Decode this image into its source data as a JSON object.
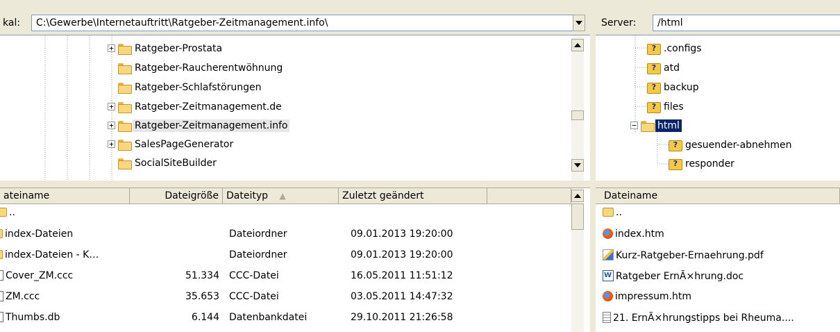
{
  "local": {
    "label": "kal:",
    "path": "C:\\Gewerbe\\Internetauftritt\\Ratgeber-Zeitmanagement.info\\",
    "tree": [
      {
        "label": "Ratgeber-Prostata",
        "expander": "+"
      },
      {
        "label": "Ratgeber-Raucherentwöhnung",
        "expander": ""
      },
      {
        "label": "Ratgeber-Schlafstörungen",
        "expander": ""
      },
      {
        "label": "Ratgeber-Zeitmanagement.de",
        "expander": "+"
      },
      {
        "label": "Ratgeber-Zeitmanagement.info",
        "expander": "+",
        "selected": true
      },
      {
        "label": "SalesPageGenerator",
        "expander": "+"
      },
      {
        "label": "SocialSiteBuilder",
        "expander": ""
      }
    ],
    "columns": [
      "ateiname",
      "Dateigröße",
      "Dateityp",
      "Zuletzt geändert"
    ],
    "sort_icon": "sort-ascending-icon",
    "files": [
      {
        "icon": "folder-up-icon",
        "name": "..",
        "size": "",
        "type": "",
        "modified": ""
      },
      {
        "icon": "folder-icon",
        "name": "index-Dateien",
        "size": "",
        "type": "Dateiordner",
        "modified": "09.01.2013 19:20:00"
      },
      {
        "icon": "folder-icon",
        "name": "index-Dateien - K…",
        "size": "",
        "type": "Dateiordner",
        "modified": "09.01.2013 19:20:00"
      },
      {
        "icon": "file-icon",
        "name": "Cover_ZM.ccc",
        "size": "51.334",
        "type": "CCC-Datei",
        "modified": "16.05.2011 11:51:12"
      },
      {
        "icon": "file-icon",
        "name": "ZM.ccc",
        "size": "35.653",
        "type": "CCC-Datei",
        "modified": "03.05.2011 14:47:32"
      },
      {
        "icon": "file-icon",
        "name": "Thumbs.db",
        "size": "6.144",
        "type": "Datenbankdatei",
        "modified": "29.10.2011 21:26:58"
      }
    ]
  },
  "server": {
    "label": "Server:",
    "path": "/html",
    "tree": [
      {
        "label": ".configs",
        "kind": "unknown"
      },
      {
        "label": "atd",
        "kind": "unknown"
      },
      {
        "label": "backup",
        "kind": "unknown"
      },
      {
        "label": "files",
        "kind": "unknown"
      },
      {
        "label": "html",
        "kind": "folder",
        "expander": "−",
        "selected": true
      },
      {
        "label": "gesuender-abnehmen",
        "kind": "unknown"
      },
      {
        "label": "responder",
        "kind": "unknown"
      }
    ],
    "columns": [
      "Dateiname"
    ],
    "files": [
      {
        "icon": "folder-up-icon",
        "name": ".."
      },
      {
        "icon": "firefox-html-icon",
        "name": "index.htm"
      },
      {
        "icon": "pdf-icon",
        "name": "Kurz-Ratgeber-Ernaehrung.pdf"
      },
      {
        "icon": "word-doc-icon",
        "name": "Ratgeber ErnÃ×hrung.doc"
      },
      {
        "icon": "firefox-html-icon",
        "name": "impressum.htm"
      },
      {
        "icon": "text-file-icon",
        "name": "21. ErnÃ×hrungstipps bei Rheuma...."
      }
    ]
  }
}
